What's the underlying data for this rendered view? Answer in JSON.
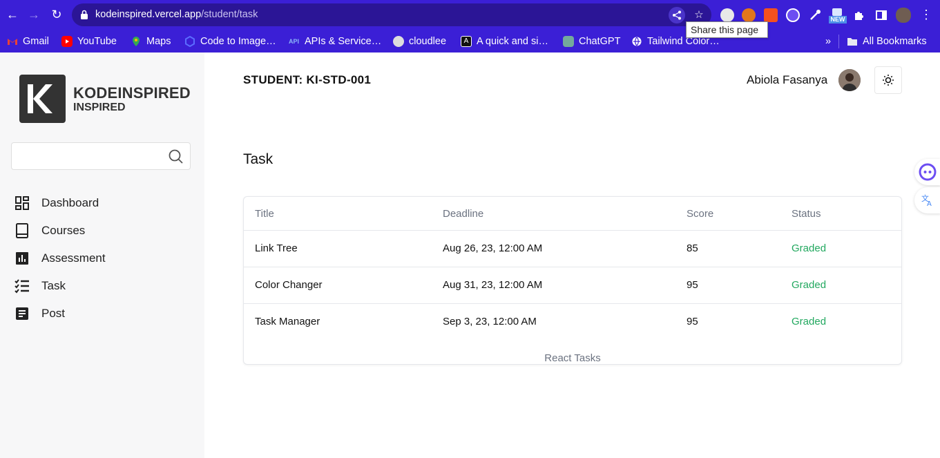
{
  "browser": {
    "url_host": "kodeinspired.vercel.app",
    "url_path": "/student/task",
    "tooltip": "Share this page",
    "ext_badge": "NEW",
    "bookmarks": [
      {
        "label": "Gmail",
        "icon": "gmail-icon",
        "color": "#ea4335"
      },
      {
        "label": "YouTube",
        "icon": "youtube-icon",
        "color": "#ff0000"
      },
      {
        "label": "Maps",
        "icon": "maps-icon",
        "color": "#34a853"
      },
      {
        "label": "Code to Image…",
        "icon": "code-image-icon",
        "color": "#5b6cff"
      },
      {
        "label": "APIs & Service…",
        "icon": "api-icon",
        "color": "#8ab4f8"
      },
      {
        "label": "cloudlee",
        "icon": "cloudlee-icon",
        "color": "#dddddd"
      },
      {
        "label": "A quick and si…",
        "icon": "angular-icon",
        "color": "#111111"
      },
      {
        "label": "ChatGPT",
        "icon": "chatgpt-icon",
        "color": "#74aa9c"
      },
      {
        "label": "Tailwind Color…",
        "icon": "globe-icon",
        "color": "#ffffff"
      }
    ],
    "overflow": "»",
    "all_bookmarks": "All Bookmarks"
  },
  "sidebar": {
    "logo_line1": "KODEINSPIRED",
    "logo_line2": "INSPIRED",
    "search_placeholder": "",
    "items": [
      {
        "label": "Dashboard",
        "icon": "dashboard-icon"
      },
      {
        "label": "Courses",
        "icon": "book-icon"
      },
      {
        "label": "Assessment",
        "icon": "chart-icon"
      },
      {
        "label": "Task",
        "icon": "checklist-icon"
      },
      {
        "label": "Post",
        "icon": "document-icon"
      }
    ]
  },
  "header": {
    "student_id": "STUDENT: KI-STD-001",
    "user_name": "Abiola Fasanya"
  },
  "main": {
    "title": "Task",
    "table": {
      "columns": [
        "Title",
        "Deadline",
        "Score",
        "Status"
      ],
      "rows": [
        {
          "title": "Link Tree",
          "deadline": "Aug 26, 23, 12:00 AM",
          "score": "85",
          "status": "Graded"
        },
        {
          "title": "Color Changer",
          "deadline": "Aug 31, 23, 12:00 AM",
          "score": "95",
          "status": "Graded"
        },
        {
          "title": "Task Manager",
          "deadline": "Sep 3, 23, 12:00 AM",
          "score": "95",
          "status": "Graded"
        }
      ],
      "caption": "React Tasks"
    }
  },
  "colors": {
    "chrome": "#3b1fd6",
    "status_graded": "#22a85f",
    "sidebar_bg": "#f7f7f8"
  }
}
